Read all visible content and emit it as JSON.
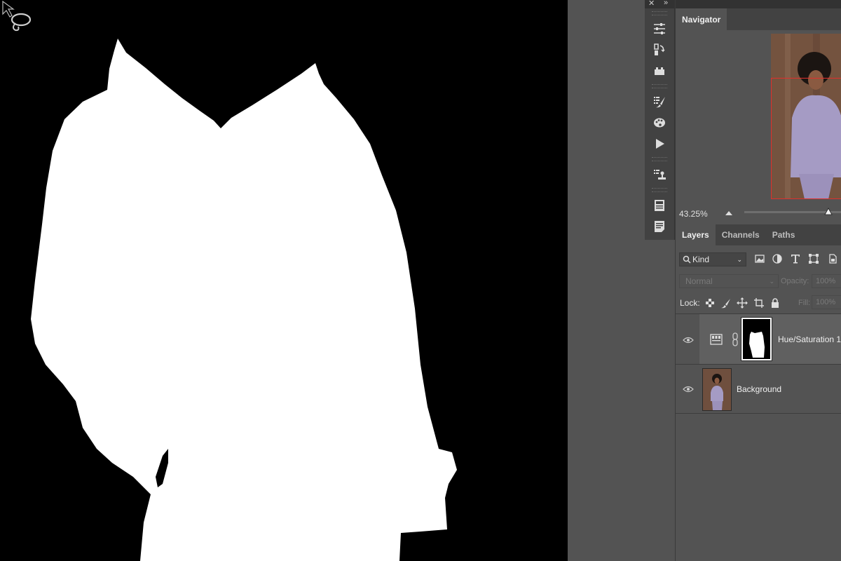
{
  "toolstrip": {
    "close_glyph": "✕",
    "collapse_glyph": "»",
    "tools": [
      "adjustments-icon",
      "history-icon",
      "actions-icon",
      "brush-presets-icon",
      "color-palette-icon",
      "play-icon",
      "clone-source-icon",
      "properties-icon",
      "notes-icon"
    ]
  },
  "navigator": {
    "tab_label": "Navigator",
    "zoom_value": "43.25%",
    "zoom_fraction": 0.95
  },
  "layers_panel": {
    "tabs": [
      "Layers",
      "Channels",
      "Paths"
    ],
    "filter_label": "Kind",
    "blend_mode": "Normal",
    "opacity_label": "Opacity:",
    "opacity_value": "100%",
    "lock_label": "Lock:",
    "fill_label": "Fill:",
    "fill_value": "100%",
    "layers": [
      {
        "name": "Hue/Saturation 1",
        "selected": true
      },
      {
        "name": "Background",
        "selected": false
      }
    ]
  },
  "colors": {
    "canvas": "#000000",
    "mask": "#ffffff",
    "panel": "#535353",
    "panel_dark": "#424242",
    "nav_frame": "#e0302c"
  }
}
